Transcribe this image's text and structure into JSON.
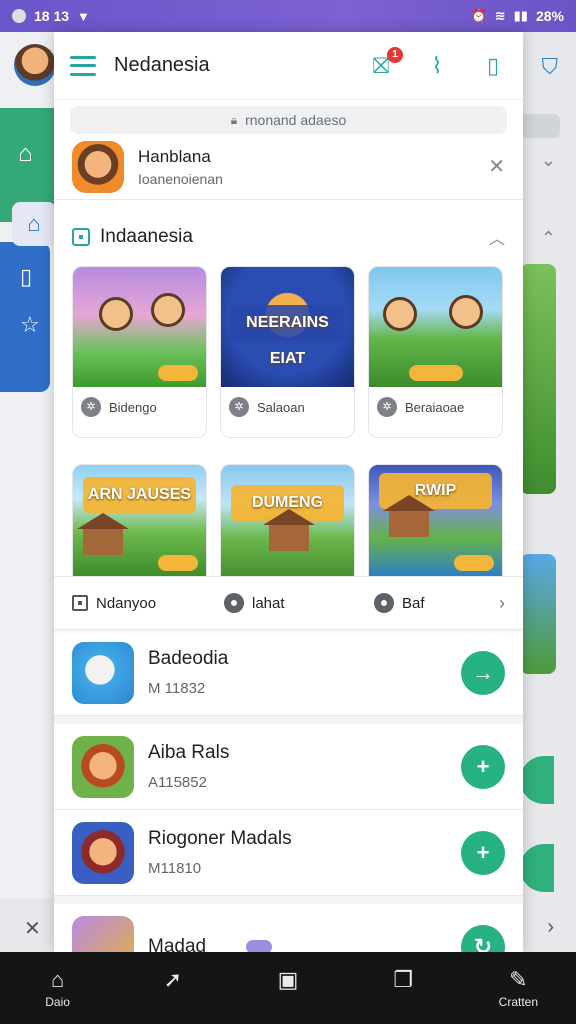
{
  "status": {
    "time": "18 13",
    "battery": "28%"
  },
  "header": {
    "title": "Nedanesia",
    "notification_count": "1"
  },
  "search": {
    "placeholder": "rnonand adaeso"
  },
  "profile": {
    "name": "Hanblana",
    "subtitle": "Ioanenoienan"
  },
  "section": {
    "title": "Indaanesia"
  },
  "games_row1": [
    {
      "label": "Bidengo",
      "thumb": "t1",
      "banner": ""
    },
    {
      "label": "Salaoan",
      "thumb": "t2",
      "banner": "NEERAINS EIAT"
    },
    {
      "label": "Beraiaoae",
      "thumb": "t3",
      "banner": ""
    }
  ],
  "games_row2": [
    {
      "thumb": "t4",
      "banner": "ARN JAUSES"
    },
    {
      "thumb": "t5",
      "banner": "DUMENG"
    },
    {
      "thumb": "t6",
      "banner": "RWIP"
    }
  ],
  "tabs": [
    {
      "label": "Ndanyoo"
    },
    {
      "label": "lahat"
    },
    {
      "label": "Baf"
    }
  ],
  "list": [
    {
      "name": "Badeodia",
      "sub": "M 11832"
    },
    {
      "name": "Aiba Rals",
      "sub": "A115852"
    },
    {
      "name": "Riogoner Madals",
      "sub": "M11810"
    },
    {
      "name": "Madad",
      "sub": ""
    }
  ],
  "nav": [
    {
      "label": "Daio",
      "icon": "home-icon"
    },
    {
      "label": "",
      "icon": "send-icon"
    },
    {
      "label": "",
      "icon": "clipboard-icon"
    },
    {
      "label": "",
      "icon": "book-icon"
    },
    {
      "label": "Cratten",
      "icon": "edit-icon"
    }
  ],
  "colors": {
    "accent": "#2aa6a0",
    "action": "#27b285",
    "status_bar": "#7c61d3"
  }
}
